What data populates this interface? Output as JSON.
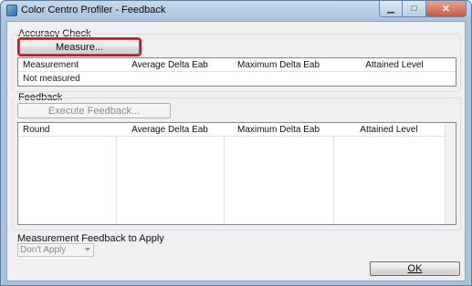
{
  "window": {
    "title": "Color Centro Profiler - Feedback",
    "caption": {
      "minimize": "▁",
      "maximize": "□",
      "close": "✕"
    }
  },
  "accuracy_check": {
    "group_label": "Accuracy Check",
    "measure_button": "Measure...",
    "table": {
      "columns": [
        "Measurement",
        "Average Delta Eab",
        "Maximum Delta Eab",
        "Attained Level"
      ],
      "rows": [
        [
          "Not measured",
          "",
          "",
          ""
        ]
      ]
    }
  },
  "feedback": {
    "group_label": "Feedback",
    "execute_button": "Execute Feedback...",
    "table": {
      "columns": [
        "Round",
        "Average Delta Eab",
        "Maximum Delta Eab",
        "Attained Level"
      ],
      "rows": []
    }
  },
  "apply": {
    "label": "Measurement Feedback to Apply",
    "selected": "Don't Apply"
  },
  "footer": {
    "ok_label": "OK"
  },
  "colors": {
    "highlight": "#d01616",
    "title_bar": "#a9c3dd",
    "close_button": "#c75a45"
  },
  "icons": {
    "app": "color-profiler-app-icon",
    "dropdown": "chevron-down-icon"
  }
}
